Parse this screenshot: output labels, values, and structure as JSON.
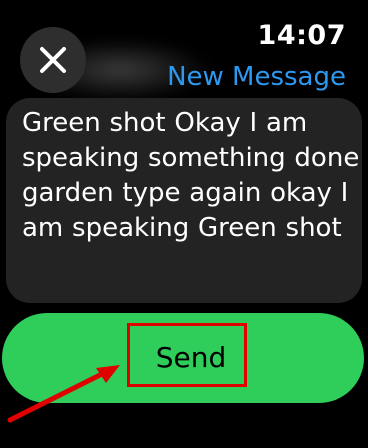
{
  "status": {
    "time": "14:07"
  },
  "header": {
    "title": "New Message",
    "close_icon": "close-icon"
  },
  "message": {
    "text": "Green shot Okay I am speaking something done garden type again okay I am speaking Green shot"
  },
  "actions": {
    "send_label": "Send"
  },
  "colors": {
    "background": "#000000",
    "accent_blue": "#2d98f0",
    "send_green": "#2fcd5a",
    "card": "#232323",
    "annotation_red": "#e00000"
  }
}
